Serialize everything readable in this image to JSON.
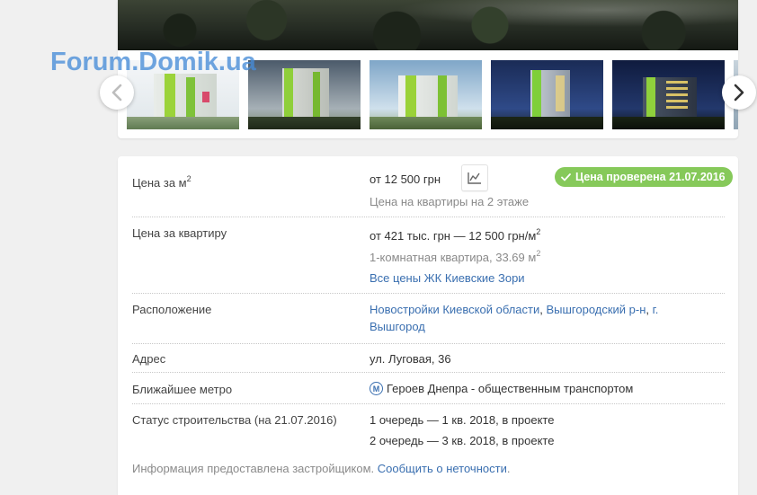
{
  "watermark": "Forum.Domik.ua",
  "gallery": {
    "thumbnails": [
      "building-render-1",
      "building-render-2",
      "building-render-3",
      "building-render-4",
      "building-render-5"
    ]
  },
  "price_per_m2": {
    "label_main": "Цена за м",
    "label_sup": "2",
    "value": "от 12 500 грн",
    "note": "Цена на квартиры на 2 этаже",
    "badge": "Цена проверена 21.07.2016",
    "badge_color": "#86c95a"
  },
  "price_per_flat": {
    "label": "Цена за квартиру",
    "value_main": "от 421 тыс. грн — 12 500 грн/м",
    "value_sup": "2",
    "note_main": "1-комнатная квартира, 33.69 м",
    "note_sup": "2",
    "link": "Все цены ЖК Киевские Зори"
  },
  "location": {
    "label": "Расположение",
    "link1": "Новостройки Киевской области",
    "sep1": ", ",
    "link2": "Вышгородский р-н",
    "sep2": ", ",
    "link3_line1": "г.",
    "link3_line2": "Вышгород"
  },
  "address": {
    "label": "Адрес",
    "value": "ул. Луговая, 36"
  },
  "metro": {
    "label": "Ближайшее метро",
    "icon_letter": "М",
    "value": "Героев Днепра - общественным транспортом"
  },
  "status": {
    "label": "Статус строительства (на 21.07.2016)",
    "lines": [
      "1 очередь — 1 кв. 2018, в проекте",
      "2 очередь — 3 кв. 2018, в проекте"
    ]
  },
  "footer": {
    "text": "Информация предоставлена застройщиком. ",
    "link": "Сообщить о неточности",
    "end": "."
  },
  "colors": {
    "link": "#3a6fb0",
    "accent_green": "#86c95a"
  }
}
